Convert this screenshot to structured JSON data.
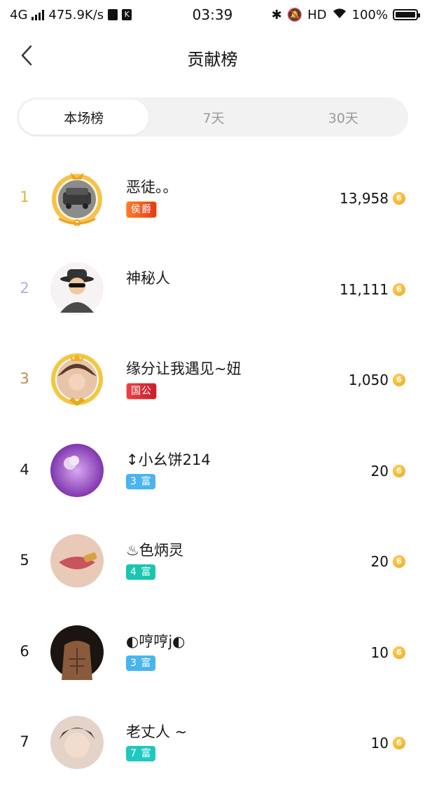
{
  "status_bar": {
    "network": "4G",
    "speed": "475.9K/s",
    "app_glyph": "K",
    "time": "03:39",
    "hd": "HD",
    "battery": "100%"
  },
  "header": {
    "title": "贡献榜"
  },
  "tabs": [
    {
      "label": "本场榜",
      "active": true
    },
    {
      "label": "7天",
      "active": false
    },
    {
      "label": "30天",
      "active": false
    }
  ],
  "rank_colors": {
    "first": "#e0b23a",
    "second": "#a9b3d8",
    "third": "#c08a45",
    "other": "#1a1a1a"
  },
  "entries": [
    {
      "rank": "1",
      "name": "恶徒。。",
      "badge": "侯爵",
      "badge_type": "noble",
      "score": "13,958"
    },
    {
      "rank": "2",
      "name": "神秘人",
      "badge": "",
      "badge_type": "",
      "score": "11,111"
    },
    {
      "rank": "3",
      "name": "缘分让我遇见~妞",
      "badge": "国公",
      "badge_type": "gov",
      "score": "1,050"
    },
    {
      "rank": "4",
      "name": "↕小幺饼214",
      "badge": "3 富",
      "badge_type": "lv3",
      "score": "20"
    },
    {
      "rank": "5",
      "name": "♨色炳灵",
      "badge": "4 富",
      "badge_type": "lv4",
      "score": "20"
    },
    {
      "rank": "6",
      "name": "◐哼哼j◐",
      "badge": "3 富",
      "badge_type": "lv3",
      "score": "10"
    },
    {
      "rank": "7",
      "name": "老丈人 ~",
      "badge": "7 富",
      "badge_type": "lv7",
      "score": "10"
    }
  ]
}
